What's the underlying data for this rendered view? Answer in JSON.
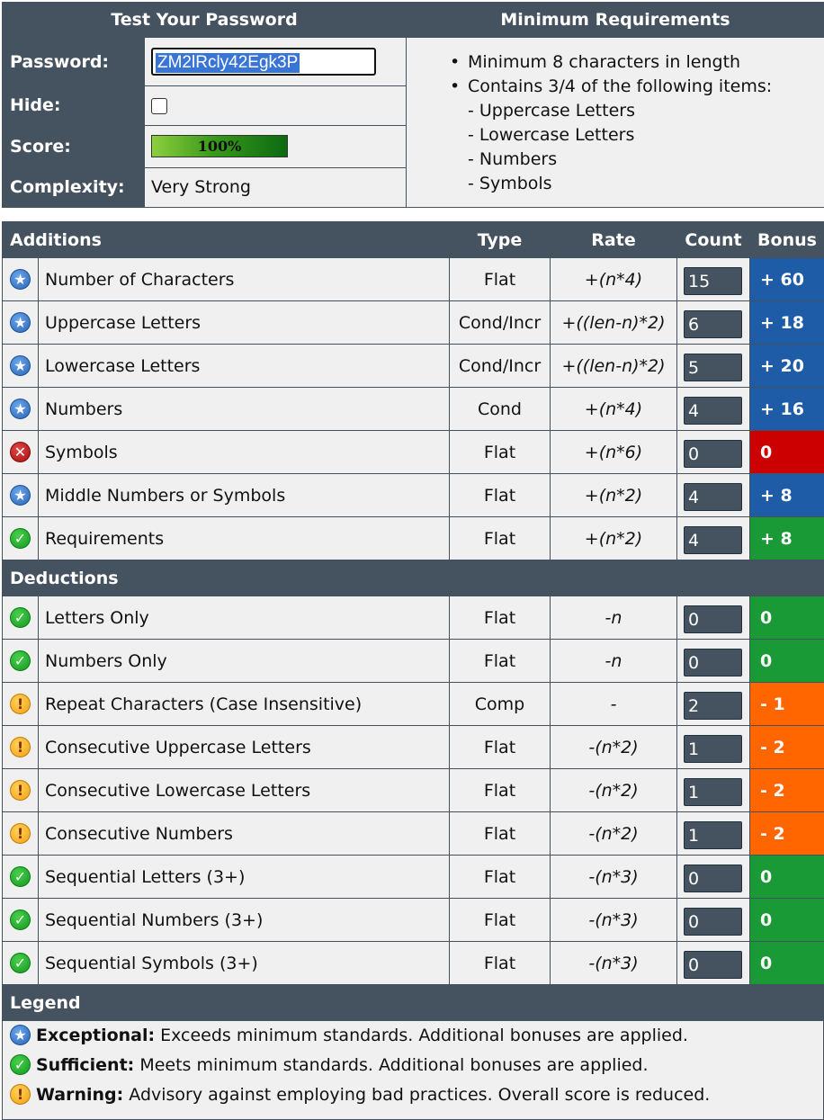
{
  "test_panel": {
    "header": "Test Your Password",
    "password_label": "Password:",
    "password_value": "ZM2lRcly42Egk3P",
    "hide_label": "Hide:",
    "score_label": "Score:",
    "score_value": "100%",
    "score_fraction": 1.0,
    "complexity_label": "Complexity:",
    "complexity_value": "Very Strong"
  },
  "requirements_panel": {
    "header": "Minimum Requirements",
    "items": [
      "Minimum 8 characters in length",
      "Contains 3/4 of the following items:"
    ],
    "sub_items": [
      "- Uppercase Letters",
      "- Lowercase Letters",
      "- Numbers",
      "- Symbols"
    ]
  },
  "columns": {
    "additions": "Additions",
    "type": "Type",
    "rate": "Rate",
    "count": "Count",
    "bonus": "Bonus"
  },
  "additions": [
    {
      "status": "exceptional",
      "icon": "star-icon",
      "name": "Number of Characters",
      "type": "Flat",
      "rate": "+(n*4)",
      "count": "15",
      "bonus": "+ 60"
    },
    {
      "status": "exceptional",
      "icon": "star-icon",
      "name": "Uppercase Letters",
      "type": "Cond/Incr",
      "rate": "+((len-n)*2)",
      "count": "6",
      "bonus": "+ 18"
    },
    {
      "status": "exceptional",
      "icon": "star-icon",
      "name": "Lowercase Letters",
      "type": "Cond/Incr",
      "rate": "+((len-n)*2)",
      "count": "5",
      "bonus": "+ 20"
    },
    {
      "status": "exceptional",
      "icon": "star-icon",
      "name": "Numbers",
      "type": "Cond",
      "rate": "+(n*4)",
      "count": "4",
      "bonus": "+ 16"
    },
    {
      "status": "failure",
      "icon": "cross-icon",
      "name": "Symbols",
      "type": "Flat",
      "rate": "+(n*6)",
      "count": "0",
      "bonus": "0"
    },
    {
      "status": "exceptional",
      "icon": "star-icon",
      "name": "Middle Numbers or Symbols",
      "type": "Flat",
      "rate": "+(n*2)",
      "count": "4",
      "bonus": "+ 8"
    },
    {
      "status": "sufficient",
      "icon": "check-icon",
      "name": "Requirements",
      "type": "Flat",
      "rate": "+(n*2)",
      "count": "4",
      "bonus": "+ 8"
    }
  ],
  "deductions_label": "Deductions",
  "deductions": [
    {
      "status": "sufficient",
      "icon": "check-icon",
      "name": "Letters Only",
      "type": "Flat",
      "rate": "-n",
      "count": "0",
      "bonus": "0"
    },
    {
      "status": "sufficient",
      "icon": "check-icon",
      "name": "Numbers Only",
      "type": "Flat",
      "rate": "-n",
      "count": "0",
      "bonus": "0"
    },
    {
      "status": "warning",
      "icon": "warning-icon",
      "name": "Repeat Characters (Case Insensitive)",
      "type": "Comp",
      "rate": "-",
      "count": "2",
      "bonus": "- 1"
    },
    {
      "status": "warning",
      "icon": "warning-icon",
      "name": "Consecutive Uppercase Letters",
      "type": "Flat",
      "rate": "-(n*2)",
      "count": "1",
      "bonus": "- 2"
    },
    {
      "status": "warning",
      "icon": "warning-icon",
      "name": "Consecutive Lowercase Letters",
      "type": "Flat",
      "rate": "-(n*2)",
      "count": "1",
      "bonus": "- 2"
    },
    {
      "status": "warning",
      "icon": "warning-icon",
      "name": "Consecutive Numbers",
      "type": "Flat",
      "rate": "-(n*2)",
      "count": "1",
      "bonus": "- 2"
    },
    {
      "status": "sufficient",
      "icon": "check-icon",
      "name": "Sequential Letters (3+)",
      "type": "Flat",
      "rate": "-(n*3)",
      "count": "0",
      "bonus": "0"
    },
    {
      "status": "sufficient",
      "icon": "check-icon",
      "name": "Sequential Numbers (3+)",
      "type": "Flat",
      "rate": "-(n*3)",
      "count": "0",
      "bonus": "0"
    },
    {
      "status": "sufficient",
      "icon": "check-icon",
      "name": "Sequential Symbols (3+)",
      "type": "Flat",
      "rate": "-(n*3)",
      "count": "0",
      "bonus": "0"
    }
  ],
  "legend": {
    "header": "Legend",
    "items": [
      {
        "icon": "star-icon",
        "term": "Exceptional:",
        "desc": " Exceeds minimum standards. Additional bonuses are applied."
      },
      {
        "icon": "check-icon",
        "term": "Sufficient:",
        "desc": " Meets minimum standards. Additional bonuses are applied."
      },
      {
        "icon": "warning-icon",
        "term": "Warning:",
        "desc": " Advisory against employing bad practices. Overall score is reduced."
      }
    ]
  },
  "colors": {
    "header_bg": "#45525f",
    "cell_bg": "#f0f0f0",
    "exceptional": "#1e5ca8",
    "sufficient": "#1a9a36",
    "warning": "#ff6600",
    "failure": "#cc0000"
  }
}
